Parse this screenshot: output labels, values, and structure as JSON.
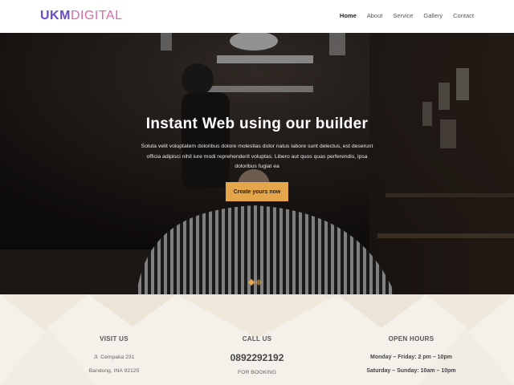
{
  "brand": {
    "part1": "UKM",
    "part2": "DIGITAL"
  },
  "nav": {
    "items": [
      "Home",
      "About",
      "Service",
      "Gallery",
      "Contact"
    ]
  },
  "hero": {
    "title": "Instant Web using our builder",
    "text": "Soluta velit voluptatem doloribus dolore molestias dolor natus labore sunt delectus, est deserunt officia adipisci nihil iure modi reprehenderit voluptas. Libero aut quos quas perferendis, ipsa doloribus fugiat ea",
    "cta": "Create yours now",
    "accent": "#e5a54b"
  },
  "info": {
    "visit": {
      "title": "VISIT US",
      "lines": [
        "Jl. Cempaka 231",
        "Bandung, INA 92125"
      ]
    },
    "call": {
      "title": "CALL US",
      "phone": "0892292192",
      "note": "FOR BOOKING"
    },
    "hours": {
      "title": "OPEN HOURS",
      "lines": [
        "Monday – Friday: 2 pm – 10pm",
        "Saturday – Sunday: 10am – 10pm"
      ]
    }
  }
}
